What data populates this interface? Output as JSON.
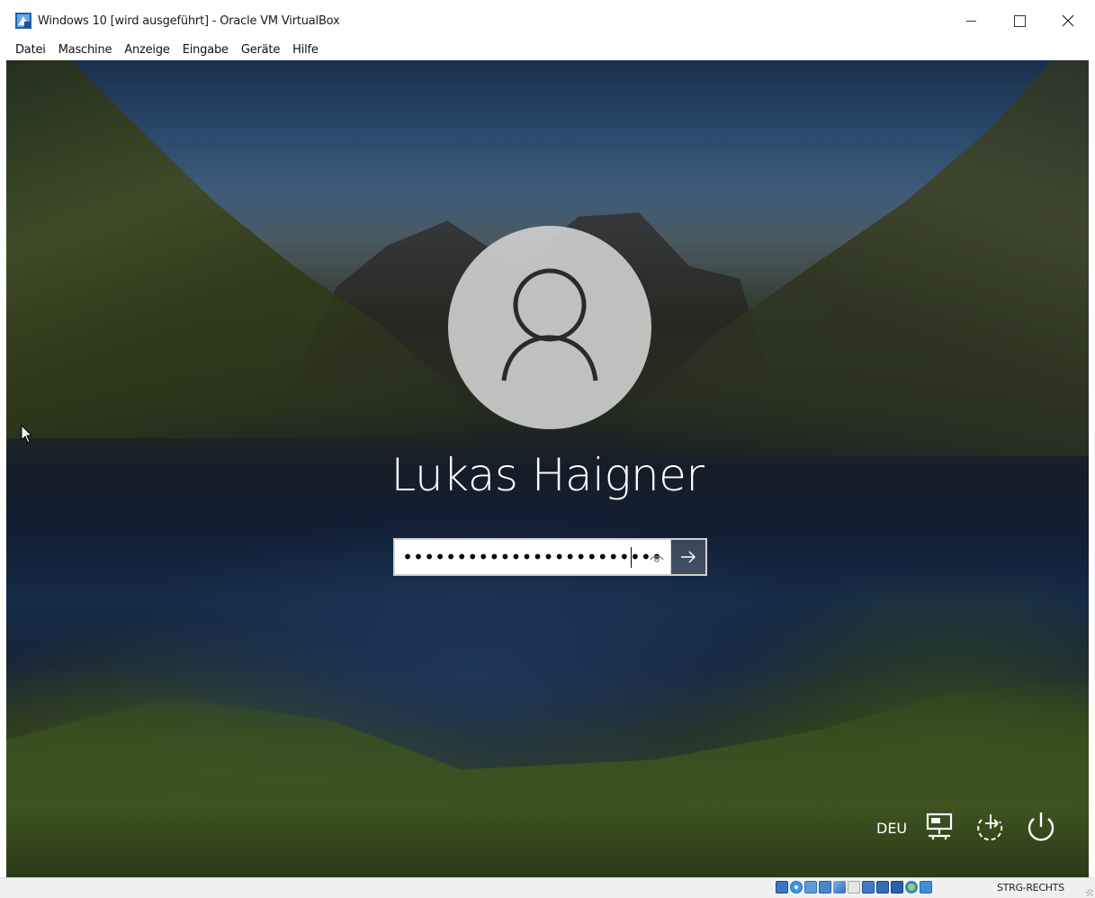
{
  "window": {
    "title": "Windows 10 [wird ausgeführt] - Oracle VM VirtualBox",
    "minimize_label": "–",
    "close_label": "✕"
  },
  "menu": {
    "items": [
      "Datei",
      "Maschine",
      "Anzeige",
      "Eingabe",
      "Geräte",
      "Hilfe"
    ]
  },
  "login": {
    "username": "Lukas Haigner",
    "password_masked": "••••••••••••••••••••••••",
    "submit_icon": "arrow-right-icon",
    "reveal_icon": "eye-icon"
  },
  "system_tray": {
    "language": "DEU",
    "icons": [
      "network-icon",
      "ease-of-access-icon",
      "power-icon"
    ]
  },
  "status_bar": {
    "host_key": "STRG-RECHTS",
    "icons": [
      "hard-disk-icon",
      "optical-drive-icon",
      "audio-icon",
      "network-adapters-icon",
      "usb-icon",
      "shared-folders-icon",
      "display-icon",
      "video-capture-icon",
      "cpu-icon",
      "mouse-integration-icon",
      "host-key-icon"
    ]
  },
  "colors": {
    "titlebar_bg": "#ffffff",
    "username_text": "#ffffff",
    "avatar_bg": "#cdcdcd",
    "statusbar_bg": "#f0f0f0"
  }
}
